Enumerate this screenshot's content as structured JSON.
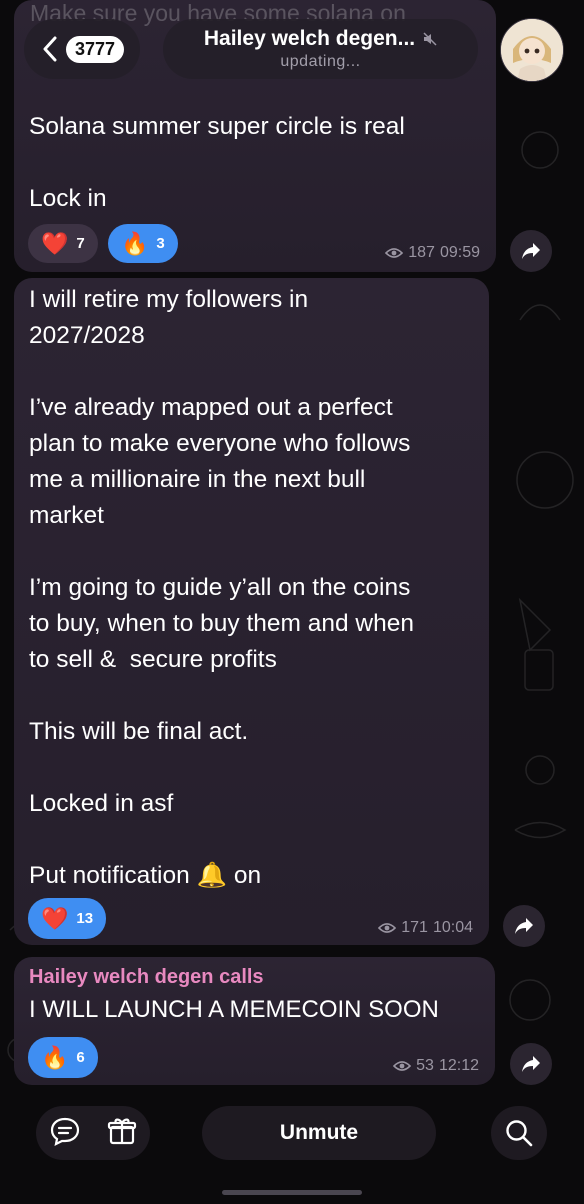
{
  "header": {
    "back_count": "3777",
    "title": "Hailey welch degen...",
    "status": "updating...",
    "ghost_text": "Make sure you have some solana on"
  },
  "messages": [
    {
      "text": "Solana summer super circle is real\n\nLock in",
      "reactions": [
        {
          "emoji": "❤️",
          "count": "7",
          "active": false
        },
        {
          "emoji": "🔥",
          "count": "3",
          "active": true
        }
      ],
      "views": "187",
      "time": "09:59"
    },
    {
      "text": "I will retire my followers in\n2027/2028\n\nI’ve already mapped out a perfect\nplan to make everyone who follows\nme a millionaire in the next bull\nmarket\n\nI’m going to guide y’all on the coins\nto buy, when to buy them and when\nto sell &  secure profits\n\nThis will be final act.\n\nLocked in asf\n\nPut notification 🔔 on",
      "reactions": [
        {
          "emoji": "❤️",
          "count": "13",
          "active": true
        }
      ],
      "views": "171",
      "time": "10:04"
    },
    {
      "sender": "Hailey welch degen calls",
      "text": "I WILL LAUNCH A MEMECOIN SOON",
      "reactions": [
        {
          "emoji": "🔥",
          "count": "6",
          "active": true
        }
      ],
      "views": "53",
      "time": "12:12"
    }
  ],
  "bottom": {
    "unmute_label": "Unmute",
    "icons": [
      "chat-bubble-icon",
      "gift-icon",
      "search-icon"
    ]
  },
  "colors": {
    "accent": "#3f8ef2",
    "sender_name": "#e889c0",
    "bubble": "#2a2330"
  }
}
